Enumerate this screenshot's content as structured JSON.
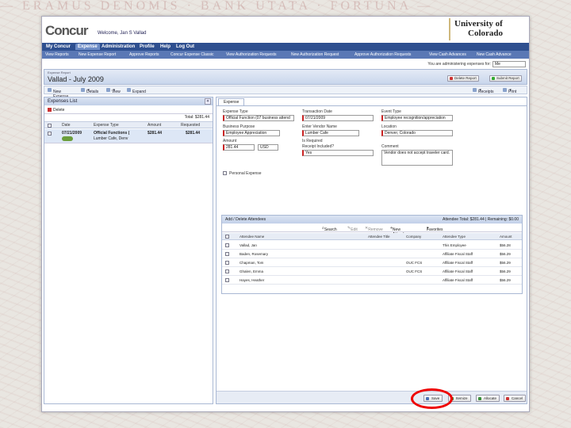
{
  "watermark": "— ERAMUS DENOMIS · BANK UTATA · FORTUNA —",
  "header": {
    "logo": "Concur",
    "welcome": "Welcome, Jan S Vallad",
    "university_line1": "University of",
    "university_line2": "Colorado"
  },
  "nav": {
    "primary": [
      "My Concur",
      "Expense",
      "Administration",
      "Profile",
      "Help",
      "Log Out"
    ],
    "secondary": [
      "View Reports",
      "New Expense Report",
      "Approve Reports",
      "Concur Expense Classic",
      "View Authorization Requests",
      "New Authorization Request",
      "Approve Authorization Requests",
      "View Cash Advances",
      "New Cash Advance"
    ]
  },
  "admin": {
    "label": "You are administering expenses for:",
    "value": "Me"
  },
  "report": {
    "caption": "Expense Report",
    "title": "Vallad - July 2009",
    "delete_label": "Delete Report",
    "submit_label": "Submit Report",
    "receipts_label": "Receipts",
    "print_label": "Print"
  },
  "toolbar": {
    "new_expense": "New Expense",
    "details": "Details",
    "view": "View",
    "expand": "Expand"
  },
  "left_panel": {
    "title": "Expenses List",
    "delete_label": "Delete",
    "total": "Total: $281.44",
    "columns": [
      "Date",
      "Expense Type",
      "Amount",
      "Requested"
    ],
    "rows": [
      {
        "date": "07/21/2009",
        "type_line1": "Official Functions (",
        "type_line2": "Lumber Cafe, Denv",
        "amount": "$281.44",
        "requested": "$281.44"
      }
    ]
  },
  "form": {
    "tab": "Expense",
    "expense_type_label": "Expense Type",
    "expense_type_value": "Official Function (07 business attend",
    "transaction_date_label": "Transaction Date",
    "transaction_date_value": "07/21/2009",
    "event_type_label": "Event Type",
    "event_type_value": "Employee recognition/appreciation",
    "business_purpose_label": "Business Purpose",
    "business_purpose_value": "Employee Appreciation",
    "vendor_label": "Enter Vendor Name",
    "vendor_value": "Lumber Cafe",
    "location_label": "Location",
    "location_value": "Denver, Colorado",
    "amount_label": "Amount",
    "amount_value": "281.44",
    "currency_value": "USD",
    "is_required_label": "Is Required",
    "receipt_label": "Receipt Included?",
    "receipt_value": "Yes",
    "comment_label": "Comment",
    "comment_value": "Vendor does not accept traveler card.",
    "personal_label": "Personal Expense"
  },
  "attendees": {
    "title": "Add / Delete Attendees",
    "total": "Attendee Total: $281.44 | Remaining: $0.00",
    "toolbar": [
      "Search",
      "Edit",
      "Remove",
      "New Attendee",
      "Favorites"
    ],
    "columns": [
      "Attendee Name",
      "Attendee Title",
      "Company",
      "Attendee Type",
      "Amount"
    ],
    "rows": [
      {
        "name": "Vallad, Jan",
        "title": "",
        "company": "",
        "type": "This Employee",
        "amount": "$56.28"
      },
      {
        "name": "Baden, Rosemary",
        "title": "",
        "company": "",
        "type": "Affiliate Fiscal Staff",
        "amount": "$56.29"
      },
      {
        "name": "Chapman, Tom",
        "title": "",
        "company": "OUC FCS",
        "type": "Affiliate Fiscal Staff",
        "amount": "$56.29"
      },
      {
        "name": "Ghalen, Emma",
        "title": "",
        "company": "OUC FCS",
        "type": "Affiliate Fiscal Staff",
        "amount": "$56.29"
      },
      {
        "name": "Hayes, Heather",
        "title": "",
        "company": "",
        "type": "Affiliate Fiscal Staff",
        "amount": "$56.29"
      }
    ]
  },
  "bottom": {
    "save": "Save",
    "itemize": "Itemize",
    "allocate": "Allocate",
    "cancel": "Cancel"
  },
  "colors": {
    "nav_primary": "#2e4f8f",
    "nav_secondary": "#5a78b5",
    "highlight_circle": "#e00000",
    "required": "#cc2222"
  }
}
